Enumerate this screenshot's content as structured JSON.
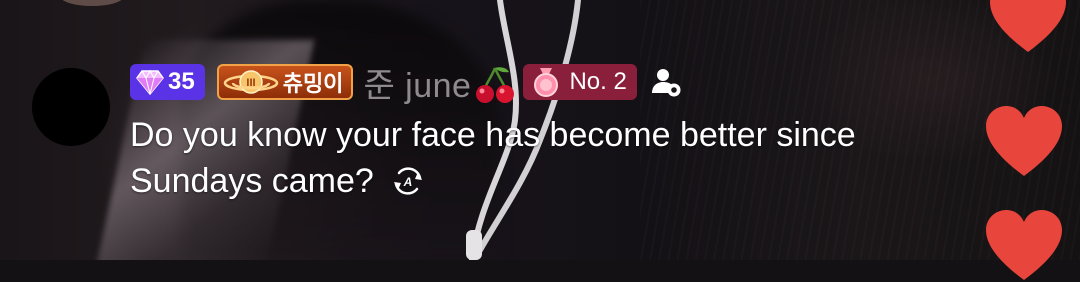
{
  "comment": {
    "gift_level": "35",
    "fan_club_name": "츄밍이",
    "username": "준 june",
    "rank_label": "No. 2",
    "message_line1": "Do you know your face has become better since",
    "message_line2": "Sundays came?"
  },
  "icons": {
    "gift_badge": "diamond-gem-icon",
    "fan_badge": "planet-heart-icon",
    "username_suffix": "cherry-icon",
    "rank_badge": "medal-icon",
    "profile_action": "person-settings-icon",
    "translate": "auto-translate-icon",
    "reaction": "heart-icon"
  },
  "colors": {
    "gift_badge_bg": "#5b33e6",
    "fan_badge_bg": "#c8531b",
    "fan_badge_border": "#f1a246",
    "rank_badge_bg": "#8a1f3b",
    "username": "#8f8a8e",
    "message": "#ffffff",
    "heart": "#e8453c"
  }
}
